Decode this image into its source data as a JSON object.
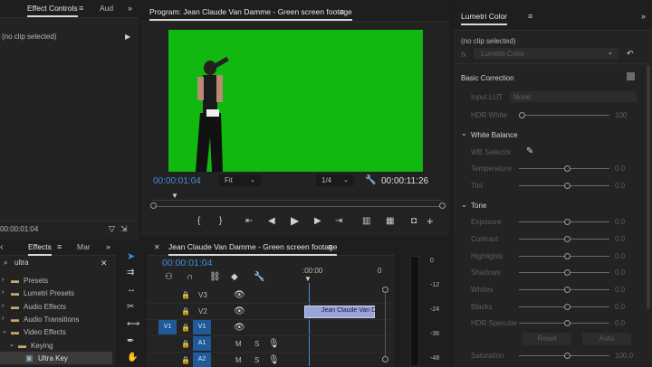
{
  "effect_controls": {
    "tab_label": "Effect Controls",
    "audio_tab": "Aud",
    "clip_status": "(no clip selected)",
    "timecode": "00:00:01:04"
  },
  "program": {
    "title": "Program: Jean Claude Van Damme - Green screen footage",
    "timecode_current": "00:00:01:04",
    "fit_value": "Fit",
    "resolution_value": "1/4",
    "timecode_duration": "00:00:11:26",
    "screen_color": "#10b810"
  },
  "effects": {
    "tab_label": "Effects",
    "markers_tab": "Mar",
    "search_value": "ultra",
    "tree": [
      {
        "label": "Presets",
        "level": 0
      },
      {
        "label": "Lumetri Presets",
        "level": 0
      },
      {
        "label": "Audio Effects",
        "level": 0
      },
      {
        "label": "Audio Transitions",
        "level": 0
      },
      {
        "label": "Video Effects",
        "level": 0
      },
      {
        "label": "Keying",
        "level": 1
      },
      {
        "label": "Ultra Key",
        "level": 2
      }
    ]
  },
  "timeline": {
    "title": "Jean Claude Van Damme - Green screen footage",
    "timecode": "00:00:01:04",
    "ruler_start": ":00:00",
    "ruler_end": "0",
    "clip_label": "Jean Claude Van Da",
    "tracks": {
      "v3": "V3",
      "v2": "V2",
      "v1": "V1",
      "v1_src": "V1",
      "a1": "A1",
      "a2": "A2",
      "m": "M",
      "s": "S"
    }
  },
  "meter": {
    "labels": [
      "0",
      "-12",
      "-24",
      "-36",
      "-48"
    ]
  },
  "lumetri": {
    "tab_label": "Lumetri Color",
    "clip_status": "(no clip selected)",
    "fx_label": "fx",
    "fx_value": "Lumetri Color",
    "basic_correction": "Basic Correction",
    "input_lut_label": "Input LUT",
    "input_lut_value": "None",
    "hdr_white_label": "HDR White",
    "hdr_white_value": "100",
    "white_balance": "White Balance",
    "wb_selector": "WB Selector",
    "temperature_label": "Temperature",
    "temperature_value": "0.0",
    "tint_label": "Tint",
    "tint_value": "0.0",
    "tone": "Tone",
    "exposure_label": "Exposure",
    "exposure_value": "0.0",
    "contrast_label": "Contrast",
    "contrast_value": "0.0",
    "highlights_label": "Highlights",
    "highlights_value": "0.0",
    "shadows_label": "Shadows",
    "shadows_value": "0.0",
    "whites_label": "Whites",
    "whites_value": "0.0",
    "blacks_label": "Blacks",
    "blacks_value": "0.0",
    "hdr_specular_label": "HDR Specular",
    "hdr_specular_value": "0.0",
    "reset_label": "Reset",
    "auto_label": "Auto",
    "saturation_label": "Saturation",
    "saturation_value": "100.0"
  }
}
